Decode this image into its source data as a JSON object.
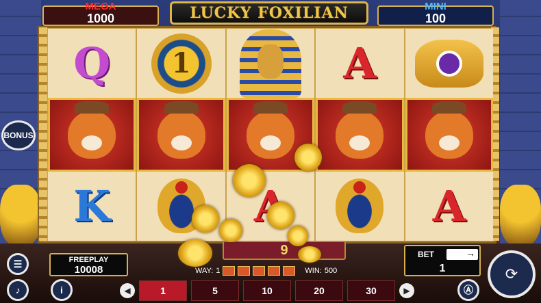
{
  "jackpots": {
    "mega": {
      "label": "MEGA",
      "value": "1000"
    },
    "mini": {
      "label": "MINI",
      "value": "100"
    }
  },
  "title": "LUCKY FOXILIAN",
  "side": {
    "bonus_label": "BONUS"
  },
  "reels": [
    [
      "Q",
      "fox",
      "K"
    ],
    [
      "1",
      "fox",
      "scarab"
    ],
    [
      "pharaoh",
      "fox",
      "A"
    ],
    [
      "A",
      "fox",
      "scarab"
    ],
    [
      "eye",
      "fox",
      "A"
    ]
  ],
  "freeplay": {
    "label": "FREEPLAY",
    "value": "10008"
  },
  "win_display": "9",
  "way": {
    "label": "WAY:",
    "value": "1"
  },
  "win": {
    "label": "WIN:",
    "value": "500"
  },
  "bet": {
    "label": "BET",
    "value": "1"
  },
  "denominations": [
    "1",
    "5",
    "10",
    "20",
    "30"
  ],
  "active_denomination": "1",
  "colors": {
    "accent": "#e0b44a",
    "mega": "#ff2a2a",
    "mini": "#4ab8ff",
    "active": "#b81a2a"
  }
}
